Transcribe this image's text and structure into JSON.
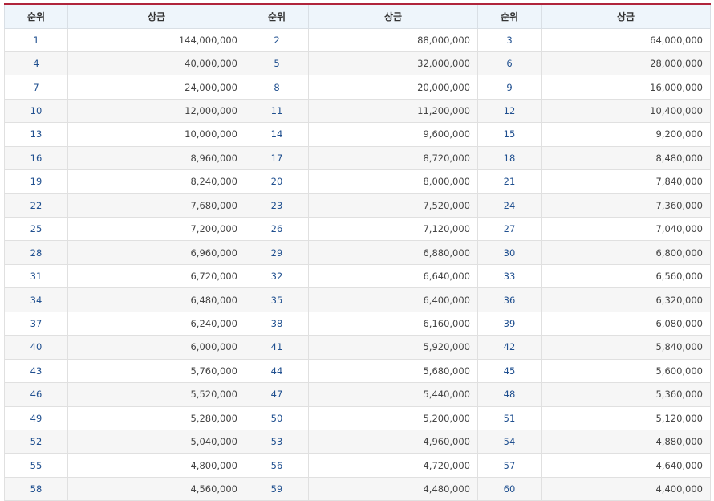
{
  "headers": [
    "순위",
    "상금",
    "순위",
    "상금",
    "순위",
    "상금"
  ],
  "rows": [
    [
      [
        "1",
        "144,000,000"
      ],
      [
        "2",
        "88,000,000"
      ],
      [
        "3",
        "64,000,000"
      ]
    ],
    [
      [
        "4",
        "40,000,000"
      ],
      [
        "5",
        "32,000,000"
      ],
      [
        "6",
        "28,000,000"
      ]
    ],
    [
      [
        "7",
        "24,000,000"
      ],
      [
        "8",
        "20,000,000"
      ],
      [
        "9",
        "16,000,000"
      ]
    ],
    [
      [
        "10",
        "12,000,000"
      ],
      [
        "11",
        "11,200,000"
      ],
      [
        "12",
        "10,400,000"
      ]
    ],
    [
      [
        "13",
        "10,000,000"
      ],
      [
        "14",
        "9,600,000"
      ],
      [
        "15",
        "9,200,000"
      ]
    ],
    [
      [
        "16",
        "8,960,000"
      ],
      [
        "17",
        "8,720,000"
      ],
      [
        "18",
        "8,480,000"
      ]
    ],
    [
      [
        "19",
        "8,240,000"
      ],
      [
        "20",
        "8,000,000"
      ],
      [
        "21",
        "7,840,000"
      ]
    ],
    [
      [
        "22",
        "7,680,000"
      ],
      [
        "23",
        "7,520,000"
      ],
      [
        "24",
        "7,360,000"
      ]
    ],
    [
      [
        "25",
        "7,200,000"
      ],
      [
        "26",
        "7,120,000"
      ],
      [
        "27",
        "7,040,000"
      ]
    ],
    [
      [
        "28",
        "6,960,000"
      ],
      [
        "29",
        "6,880,000"
      ],
      [
        "30",
        "6,800,000"
      ]
    ],
    [
      [
        "31",
        "6,720,000"
      ],
      [
        "32",
        "6,640,000"
      ],
      [
        "33",
        "6,560,000"
      ]
    ],
    [
      [
        "34",
        "6,480,000"
      ],
      [
        "35",
        "6,400,000"
      ],
      [
        "36",
        "6,320,000"
      ]
    ],
    [
      [
        "37",
        "6,240,000"
      ],
      [
        "38",
        "6,160,000"
      ],
      [
        "39",
        "6,080,000"
      ]
    ],
    [
      [
        "40",
        "6,000,000"
      ],
      [
        "41",
        "5,920,000"
      ],
      [
        "42",
        "5,840,000"
      ]
    ],
    [
      [
        "43",
        "5,760,000"
      ],
      [
        "44",
        "5,680,000"
      ],
      [
        "45",
        "5,600,000"
      ]
    ],
    [
      [
        "46",
        "5,520,000"
      ],
      [
        "47",
        "5,440,000"
      ],
      [
        "48",
        "5,360,000"
      ]
    ],
    [
      [
        "49",
        "5,280,000"
      ],
      [
        "50",
        "5,200,000"
      ],
      [
        "51",
        "5,120,000"
      ]
    ],
    [
      [
        "52",
        "5,040,000"
      ],
      [
        "53",
        "4,960,000"
      ],
      [
        "54",
        "4,880,000"
      ]
    ],
    [
      [
        "55",
        "4,800,000"
      ],
      [
        "56",
        "4,720,000"
      ],
      [
        "57",
        "4,640,000"
      ]
    ],
    [
      [
        "58",
        "4,560,000"
      ],
      [
        "59",
        "4,480,000"
      ],
      [
        "60",
        "4,400,000"
      ]
    ]
  ]
}
